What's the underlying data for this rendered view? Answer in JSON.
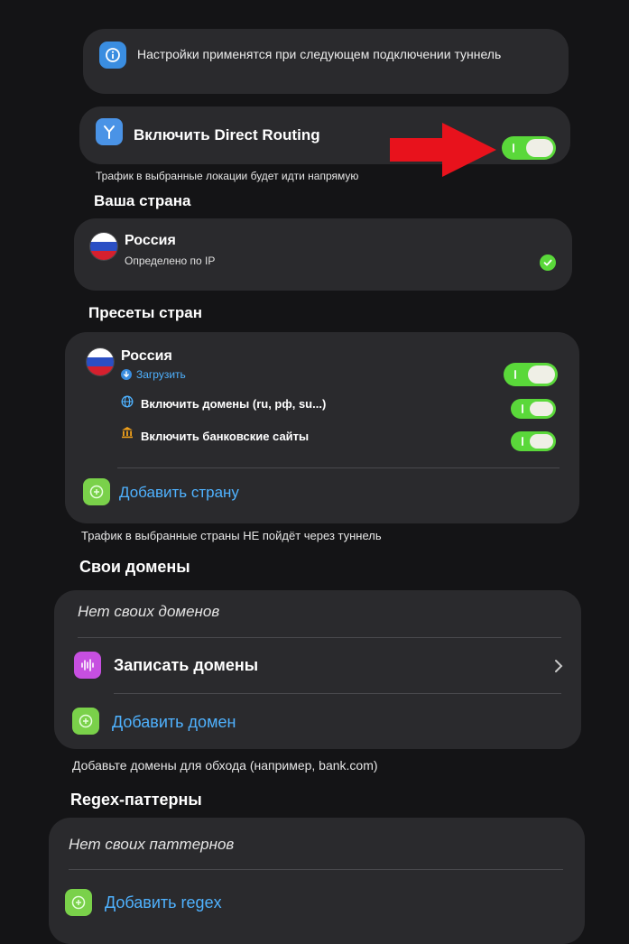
{
  "info_banner": {
    "text": "Настройки применятся при следующем подключении туннель"
  },
  "direct_routing": {
    "label": "Включить Direct Routing",
    "enabled": true,
    "footnote": "Трафик в выбранные локации будет идти напрямую"
  },
  "your_country": {
    "section_title": "Ваша страна",
    "country": "Россия",
    "subtitle": "Определено по IP"
  },
  "country_presets": {
    "section_title": "Пресеты стран",
    "preset": {
      "country": "Россия",
      "download_label": "Загрузить",
      "enabled": true,
      "options": [
        {
          "label": "Включить домены (ru, рф, su...)",
          "enabled": true
        },
        {
          "label": "Включить банковские сайты",
          "enabled": true
        }
      ]
    },
    "add_label": "Добавить страну",
    "footnote": "Трафик в выбранные страны НЕ пойдёт через туннель"
  },
  "custom_domains": {
    "section_title": "Свои домены",
    "empty_text": "Нет своих доменов",
    "record_label": "Записать домены",
    "add_label": "Добавить домен",
    "footnote": "Добавьте домены для обхода (например, bank.com)"
  },
  "regex": {
    "section_title": "Regex-паттерны",
    "empty_text": "Нет своих паттернов",
    "add_label": "Добавить regex"
  },
  "colors": {
    "background": "#141416",
    "card": "#2a2a2d",
    "toggle_on": "#5ad83a",
    "link": "#4fb2ff",
    "arrow": "#e8121c"
  }
}
